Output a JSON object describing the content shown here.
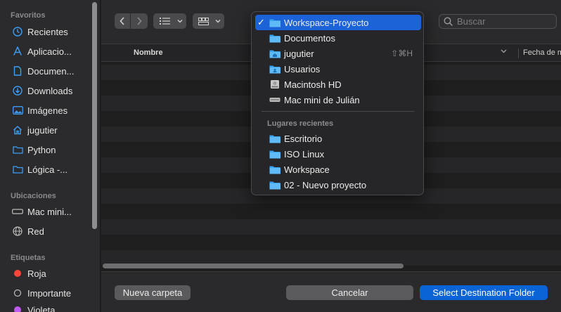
{
  "sidebar": {
    "favorites_heading": "Favoritos",
    "favorites": [
      {
        "label": "Recientes",
        "icon": "clock-icon"
      },
      {
        "label": "Aplicacio...",
        "icon": "applications-icon"
      },
      {
        "label": "Documen...",
        "icon": "document-icon"
      },
      {
        "label": "Downloads",
        "icon": "download-icon"
      },
      {
        "label": "Imágenes",
        "icon": "photo-icon"
      },
      {
        "label": "jugutier",
        "icon": "home-icon"
      },
      {
        "label": "Python",
        "icon": "folder-icon"
      },
      {
        "label": "Lógica -...",
        "icon": "folder-icon"
      }
    ],
    "locations_heading": "Ubicaciones",
    "locations": [
      {
        "label": "Mac mini...",
        "icon": "computer-icon"
      },
      {
        "label": "Red",
        "icon": "network-icon"
      }
    ],
    "tags_heading": "Etiquetas",
    "tags": [
      {
        "label": "Roja",
        "color": "#ff453a"
      },
      {
        "label": "Importante",
        "color": "outline"
      },
      {
        "label": "Violeta",
        "color": "#bf5af2"
      }
    ]
  },
  "toolbar": {
    "search_placeholder": "Buscar"
  },
  "list": {
    "col_name": "Nombre",
    "col_date": "Fecha de m"
  },
  "menu": {
    "items": [
      {
        "label": "Workspace-Proyecto",
        "icon": "folder-icon",
        "selected": true
      },
      {
        "label": "Documentos",
        "icon": "folder-icon"
      },
      {
        "label": "jugutier",
        "icon": "home-folder-icon",
        "shortcut": "⇧⌘H"
      },
      {
        "label": "Usuarios",
        "icon": "users-folder-icon"
      },
      {
        "label": "Macintosh HD",
        "icon": "hard-drive-icon"
      },
      {
        "label": "Mac mini de Julián",
        "icon": "mac-mini-icon"
      }
    ],
    "recent_heading": "Lugares recientes",
    "recent": [
      {
        "label": "Escritorio",
        "icon": "folder-icon"
      },
      {
        "label": "ISO Linux",
        "icon": "folder-icon"
      },
      {
        "label": "Workspace",
        "icon": "folder-icon"
      },
      {
        "label": "02 - Nuevo proyecto",
        "icon": "folder-icon"
      }
    ]
  },
  "buttons": {
    "new_folder": "Nueva carpeta",
    "cancel": "Cancelar",
    "select": "Select Destination Folder"
  },
  "colors": {
    "accent": "#0a64d6",
    "folder": "#3aa3f0"
  }
}
